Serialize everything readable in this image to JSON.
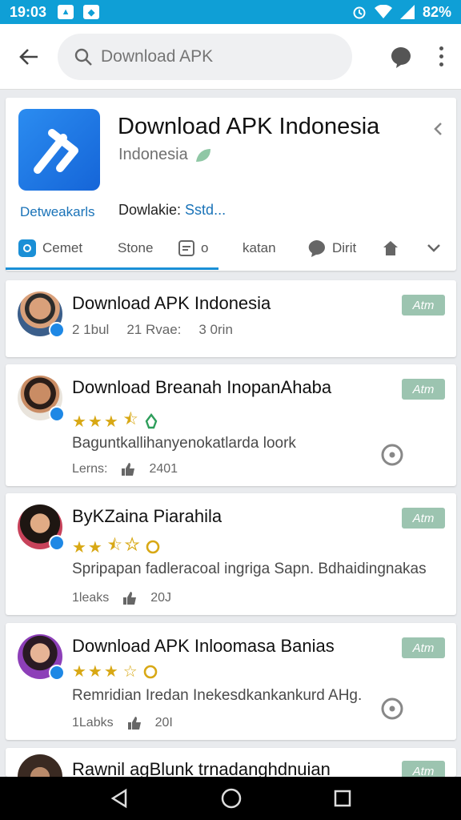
{
  "status": {
    "time": "19:03",
    "battery": "82%"
  },
  "search": {
    "placeholder": "Download APK"
  },
  "app": {
    "title": "Download APK Indonesia",
    "subtitle": "Indonesia",
    "developer": "Detweakarls",
    "download_label": "Dowlakie:",
    "download_value": "Sstd...",
    "tabs": [
      {
        "label": "Cemet"
      },
      {
        "label": "Stone"
      },
      {
        "label": "o"
      },
      {
        "label": "katan"
      },
      {
        "label": "Dirit"
      }
    ]
  },
  "reviews": [
    {
      "name": "Download APK Indonesia",
      "badge": "Atm",
      "meta": [
        "2 1bul",
        "21 Rvae:",
        "3 0rin"
      ]
    },
    {
      "name": "Download Breanah InopanAhaba",
      "badge": "Atm",
      "rating": 3.5,
      "text": "Baguntkallihanyenokatlarda loork",
      "count_label": "Lerns:",
      "count": "2401"
    },
    {
      "name": "ByKZaina Piarahila",
      "badge": "Atm",
      "rating": 2.5,
      "text": "Spripapan fadleracoal ingriga Sapn. Bdhaidingnakas",
      "count_label": "1leaks",
      "count": "20J"
    },
    {
      "name": "Download APK Inloomasa Banias",
      "badge": "Atm",
      "rating": 3.5,
      "text": "Remridian Iredan Inekesdkankankurd AHg.",
      "count_label": "1Labks",
      "count": "20I"
    },
    {
      "name": "Rawnil agBlunk trnadanghdnuian",
      "badge": "Atm"
    }
  ]
}
